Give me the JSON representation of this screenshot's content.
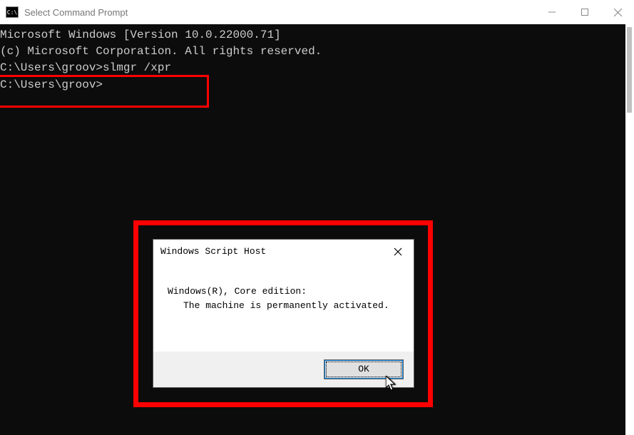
{
  "titlebar": {
    "icon_label": "C:\\",
    "title": "Select Command Prompt",
    "minimize": "—",
    "maximize": "□",
    "close": "×"
  },
  "terminal": {
    "line1": "Microsoft Windows [Version 10.0.22000.71]",
    "line2": "(c) Microsoft Corporation. All rights reserved.",
    "blank1": "",
    "prompt1_prefix": "C:\\Users\\groov>",
    "prompt1_command": "slmgr /xpr",
    "blank2": "",
    "prompt2": "C:\\Users\\groov>"
  },
  "dialog": {
    "title": "Windows Script Host",
    "close": "×",
    "message_line1": "Windows(R), Core edition:",
    "message_line2": "The machine is permanently activated.",
    "ok_label": "OK"
  },
  "annotations": {
    "command_highlight_color": "#ff0000",
    "dialog_highlight_color": "#ff0000"
  }
}
